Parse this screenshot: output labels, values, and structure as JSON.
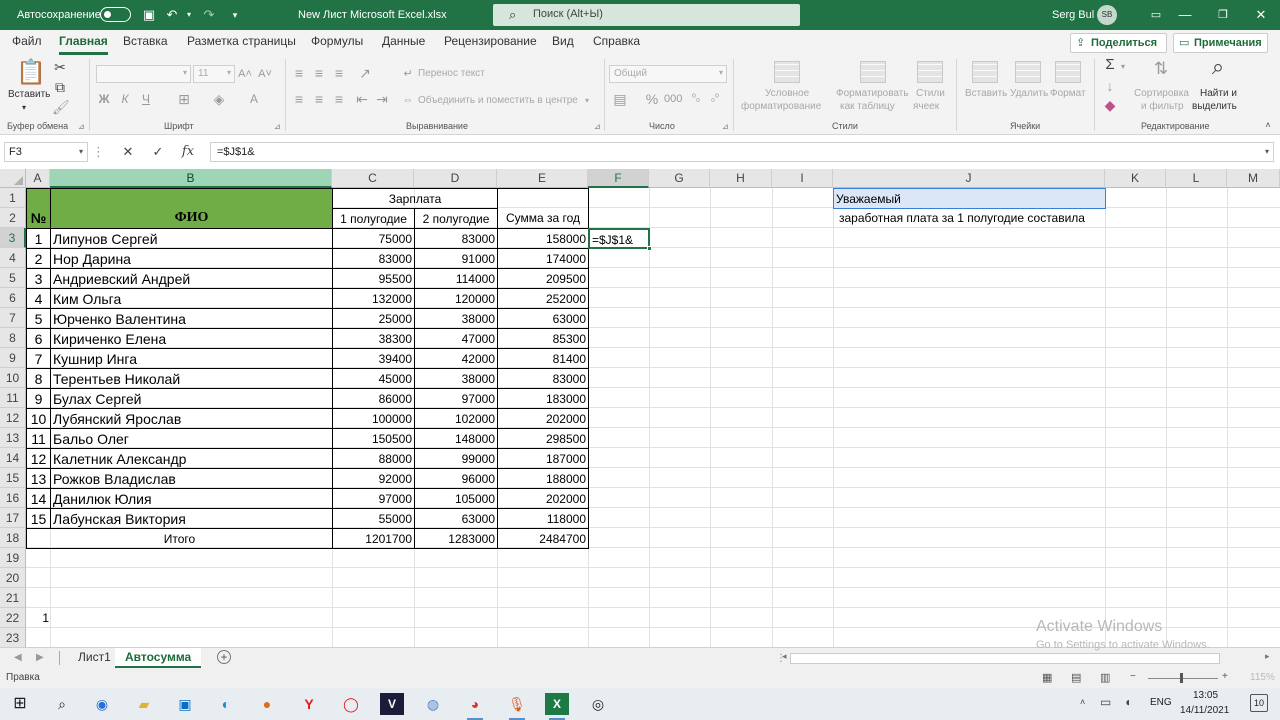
{
  "titlebar": {
    "autosave_label": "Автосохранение",
    "document_title": "New Лист Microsoft Excel.xlsx",
    "search_placeholder": "Поиск (Alt+Ы)",
    "user_name": "Serg Bul",
    "user_initials": "SB"
  },
  "menu": {
    "tabs": [
      "Файл",
      "Главная",
      "Вставка",
      "Разметка страницы",
      "Формулы",
      "Данные",
      "Рецензирование",
      "Вид",
      "Справка"
    ],
    "active_tab": "Главная",
    "share_label": "Поделиться",
    "comments_label": "Примечания"
  },
  "ribbon": {
    "clipboard": {
      "paste_label": "Вставить",
      "group_label": "Буфер обмена"
    },
    "font": {
      "font_size": "11",
      "group_label": "Шрифт"
    },
    "alignment": {
      "wrap_label": "Перенос текст",
      "merge_label": "Объединить и поместить в центре",
      "group_label": "Выравнивание"
    },
    "number": {
      "format_value": "Общий",
      "group_label": "Число"
    },
    "styles": {
      "conditional_label_1": "Условное",
      "conditional_label_2": "форматирование",
      "table_label_1": "Форматировать",
      "table_label_2": "как таблицу",
      "cellstyles_label_1": "Стили",
      "cellstyles_label_2": "ячеек",
      "group_label": "Стили"
    },
    "cells": {
      "insert_label": "Вставить",
      "delete_label": "Удалить",
      "format_label": "Формат",
      "group_label": "Ячейки"
    },
    "editing": {
      "sort_label_1": "Сортировка",
      "sort_label_2": "и фильтр",
      "find_label_1": "Найти и",
      "find_label_2": "выделить",
      "group_label": "Редактирование"
    }
  },
  "formula_bar": {
    "name_box": "F3",
    "formula": "=$J$1&"
  },
  "sheet": {
    "columns": [
      "A",
      "B",
      "C",
      "D",
      "E",
      "F",
      "G",
      "H",
      "I",
      "J",
      "K",
      "L",
      "M"
    ],
    "row_numbers": [
      "1",
      "2",
      "3",
      "4",
      "5",
      "6",
      "7",
      "8",
      "9",
      "10",
      "11",
      "12",
      "13",
      "14",
      "15",
      "16",
      "17",
      "18",
      "19",
      "20",
      "21",
      "22",
      "23"
    ],
    "header": {
      "num": "№",
      "fio": "ФИО",
      "salary": "Зарплата",
      "half1": "1 полугодие",
      "half2": "2 полугодие",
      "total_year": "Сумма за год"
    },
    "rows": [
      {
        "n": "1",
        "name": "Липунов Сергей",
        "h1": "75000",
        "h2": "83000",
        "sum": "158000"
      },
      {
        "n": "2",
        "name": "Нор Дарина",
        "h1": "83000",
        "h2": "91000",
        "sum": "174000"
      },
      {
        "n": "3",
        "name": "Андриевский Андрей",
        "h1": "95500",
        "h2": "114000",
        "sum": "209500"
      },
      {
        "n": "4",
        "name": "Ким Ольга",
        "h1": "132000",
        "h2": "120000",
        "sum": "252000"
      },
      {
        "n": "5",
        "name": "Юрченко Валентина",
        "h1": "25000",
        "h2": "38000",
        "sum": "63000"
      },
      {
        "n": "6",
        "name": "Кириченко Елена",
        "h1": "38300",
        "h2": "47000",
        "sum": "85300"
      },
      {
        "n": "7",
        "name": "Кушнир Инга",
        "h1": "39400",
        "h2": "42000",
        "sum": "81400"
      },
      {
        "n": "8",
        "name": "Терентьев Николай",
        "h1": "45000",
        "h2": "38000",
        "sum": "83000"
      },
      {
        "n": "9",
        "name": "Булах Сергей",
        "h1": "86000",
        "h2": "97000",
        "sum": "183000"
      },
      {
        "n": "10",
        "name": "Лубянский Ярослав",
        "h1": "100000",
        "h2": "102000",
        "sum": "202000"
      },
      {
        "n": "11",
        "name": "Бальо Олег",
        "h1": "150500",
        "h2": "148000",
        "sum": "298500"
      },
      {
        "n": "12",
        "name": "Калетник Александр",
        "h1": "88000",
        "h2": "99000",
        "sum": "187000"
      },
      {
        "n": "13",
        "name": "Рожков Владислав",
        "h1": "92000",
        "h2": "96000",
        "sum": "188000"
      },
      {
        "n": "14",
        "name": "Данилюк Юлия",
        "h1": "97000",
        "h2": "105000",
        "sum": "202000"
      },
      {
        "n": "15",
        "name": "Лабунская Виктория",
        "h1": "55000",
        "h2": "63000",
        "sum": "118000"
      }
    ],
    "totals": {
      "label": "Итого",
      "h1": "1201700",
      "h2": "1283000",
      "sum": "2484700"
    },
    "f3_editing": "=$J$1&",
    "j1_text": "Уважаемый",
    "j2_text": "заработная плата за 1 полугодие составила",
    "a22_value": "1"
  },
  "sheet_tabs": [
    "Лист1",
    "Автосумма"
  ],
  "active_sheet": "Автосумма",
  "status": {
    "mode": "Правка",
    "zoom": "115%"
  },
  "watermark": {
    "line1": "Activate Windows",
    "line2": "Go to Settings to activate Windows."
  },
  "taskbar": {
    "lang": "ENG",
    "time": "13:05",
    "date": "14/11/2021",
    "notifications": "10"
  },
  "colors": {
    "excel_green": "#217346",
    "header_fill": "#70ad47"
  }
}
